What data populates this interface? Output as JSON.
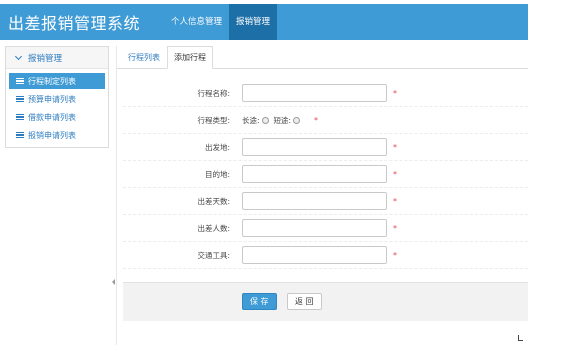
{
  "header": {
    "app_title": "出差报销管理系统",
    "nav": [
      {
        "label": "个人信息管理",
        "active": false
      },
      {
        "label": "报销管理",
        "active": true
      }
    ]
  },
  "sidebar": {
    "section_title": "报销管理",
    "items": [
      {
        "label": "行程制定列表",
        "active": true
      },
      {
        "label": "预算申请列表",
        "active": false
      },
      {
        "label": "借款申请列表",
        "active": false
      },
      {
        "label": "报销申请列表",
        "active": false
      }
    ]
  },
  "tabs": [
    {
      "label": "行程列表",
      "active": false
    },
    {
      "label": "添加行程",
      "active": true
    }
  ],
  "form": {
    "trip_name_label": "行程名称:",
    "trip_name_value": "",
    "trip_type_label": "行程类型:",
    "trip_type_options": [
      "长途:",
      "短途:"
    ],
    "trip_type_selected": null,
    "departure_label": "出发地:",
    "departure_value": "",
    "destination_label": "目的地:",
    "destination_value": "",
    "days_label": "出差天数:",
    "days_value": "",
    "people_label": "出差人数:",
    "people_value": "",
    "transport_label": "交通工具:",
    "transport_value": "",
    "required_mark": "*"
  },
  "actions": {
    "save_label": "保 存",
    "back_label": "返 回"
  },
  "colors": {
    "header_bg": "#3f9bd6",
    "nav_active_bg": "#1d6fa7",
    "link_blue": "#2e7cc0",
    "required_red": "#e5484d"
  }
}
